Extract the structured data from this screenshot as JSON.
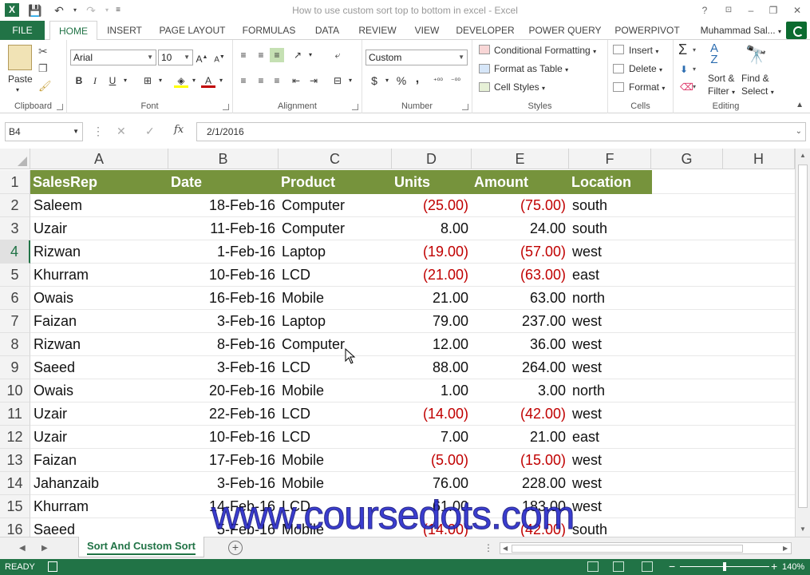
{
  "window": {
    "title": "How to use custom sort top to bottom in excel - Excel",
    "app_logo": "X",
    "qat": [
      "save-icon",
      "undo-icon",
      "redo-icon",
      "customize-icon"
    ],
    "controls": [
      "?",
      "restore-ribbon-icon",
      "–",
      "❐",
      "✕"
    ]
  },
  "tabs": [
    "FILE",
    "HOME",
    "INSERT",
    "PAGE LAYOUT",
    "FORMULAS",
    "DATA",
    "REVIEW",
    "VIEW",
    "DEVELOPER",
    "POWER QUERY",
    "POWERPIVOT"
  ],
  "active_tab": "HOME",
  "user": "Muhammad Sal...",
  "ribbon": {
    "clipboard": {
      "paste": "Paste",
      "label": "Clipboard"
    },
    "font": {
      "name": "Arial",
      "size": "10",
      "bold": "B",
      "italic": "I",
      "underline": "U",
      "label": "Font"
    },
    "alignment": {
      "label": "Alignment"
    },
    "number": {
      "format": "Custom",
      "currency": "$",
      "percent": "%",
      "comma": ",",
      "inc_dec": "⁺⁰⁰",
      "dec_dec": "⁻⁰⁰",
      "label": "Number"
    },
    "styles": {
      "conditional": "Conditional Formatting",
      "table": "Format as Table",
      "cell": "Cell Styles",
      "label": "Styles"
    },
    "cells": {
      "insert": "Insert",
      "delete": "Delete",
      "format": "Format",
      "label": "Cells"
    },
    "editing": {
      "sort": "Sort &",
      "filter": "Filter",
      "find": "Find &",
      "select": "Select",
      "label": "Editing"
    }
  },
  "formula_bar": {
    "name_box": "B4",
    "formula": "2/1/2016",
    "fx": "fx",
    "cancel": "✕",
    "enter": "✓",
    "dots": "⋮"
  },
  "columns": [
    "A",
    "B",
    "C",
    "D",
    "E",
    "F",
    "G",
    "H"
  ],
  "header_row": [
    "SalesRep",
    "Date",
    "Product",
    "Units",
    "Amount",
    "Location"
  ],
  "rows": [
    [
      "Saleem",
      "18-Feb-16",
      "Computer",
      "(25.00)",
      "(75.00)",
      "south"
    ],
    [
      "Uzair",
      "11-Feb-16",
      "Computer",
      "8.00",
      "24.00",
      "south"
    ],
    [
      "Rizwan",
      "1-Feb-16",
      "Laptop",
      "(19.00)",
      "(57.00)",
      "west"
    ],
    [
      "Khurram",
      "10-Feb-16",
      "LCD",
      "(21.00)",
      "(63.00)",
      "east"
    ],
    [
      "Owais",
      "16-Feb-16",
      "Mobile",
      "21.00",
      "63.00",
      "north"
    ],
    [
      "Faizan",
      "3-Feb-16",
      "Laptop",
      "79.00",
      "237.00",
      "west"
    ],
    [
      "Rizwan",
      "8-Feb-16",
      "Computer",
      "12.00",
      "36.00",
      "west"
    ],
    [
      "Saeed",
      "3-Feb-16",
      "LCD",
      "88.00",
      "264.00",
      "west"
    ],
    [
      "Owais",
      "20-Feb-16",
      "Mobile",
      "1.00",
      "3.00",
      "north"
    ],
    [
      "Uzair",
      "22-Feb-16",
      "LCD",
      "(14.00)",
      "(42.00)",
      "west"
    ],
    [
      "Uzair",
      "10-Feb-16",
      "LCD",
      "7.00",
      "21.00",
      "east"
    ],
    [
      "Faizan",
      "17-Feb-16",
      "Mobile",
      "(5.00)",
      "(15.00)",
      "west"
    ],
    [
      "Jahanzaib",
      "3-Feb-16",
      "Mobile",
      "76.00",
      "228.00",
      "west"
    ],
    [
      "Khurram",
      "14-Feb-16",
      "LCD",
      "61.00",
      "183.00",
      "west"
    ],
    [
      "Saeed",
      "5-Feb-16",
      "Mobile",
      "(14.00)",
      "(42.00)",
      "south"
    ]
  ],
  "row_numbers": [
    "1",
    "2",
    "3",
    "4",
    "5",
    "6",
    "7",
    "8",
    "9",
    "10",
    "11",
    "12",
    "13",
    "14",
    "15",
    "16"
  ],
  "selected_row": "4",
  "colors": {
    "header_fill": "#76933c",
    "negative": "#c00000",
    "excel_green": "#217346"
  },
  "sheet_tabs": [
    "Sort And Custom Sort"
  ],
  "status": {
    "ready": "READY",
    "zoom": "140%"
  },
  "watermark": "www.coursedots.com"
}
